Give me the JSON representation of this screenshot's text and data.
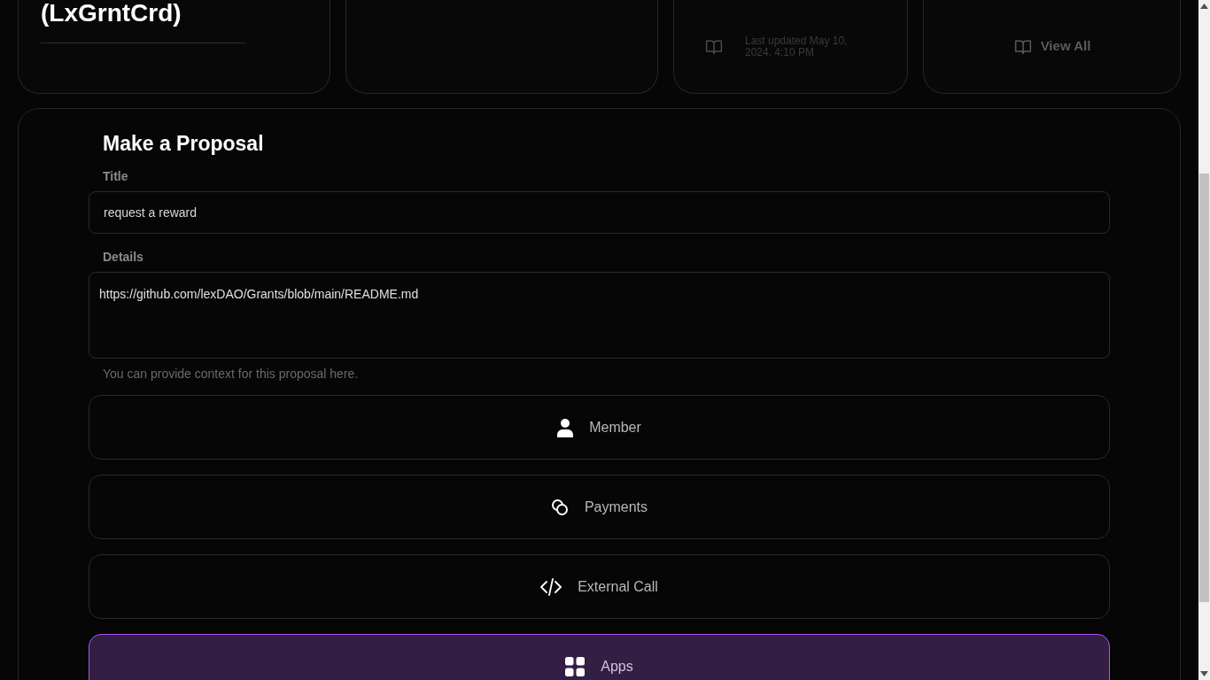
{
  "top_cards": [
    {
      "kind": "title",
      "title": "(LxGrntCrd)"
    },
    {
      "kind": "empty"
    },
    {
      "kind": "updated",
      "text": "Last updated May 10, 2024, 4:10 PM"
    },
    {
      "kind": "link",
      "text": "View All"
    }
  ],
  "proposal": {
    "heading": "Make a Proposal",
    "title_label": "Title",
    "title_value": "request a reward",
    "details_label": "Details",
    "details_value": "https://github.com/lexDAO/Grants/blob/main/README.md",
    "details_help": "You can provide context for this proposal here.",
    "actions": [
      {
        "kind": "member",
        "label": "Member",
        "selected": false
      },
      {
        "kind": "payments",
        "label": "Payments",
        "selected": false
      },
      {
        "kind": "external",
        "label": "External Call",
        "selected": false
      },
      {
        "kind": "apps",
        "label": "Apps",
        "selected": true
      }
    ]
  }
}
